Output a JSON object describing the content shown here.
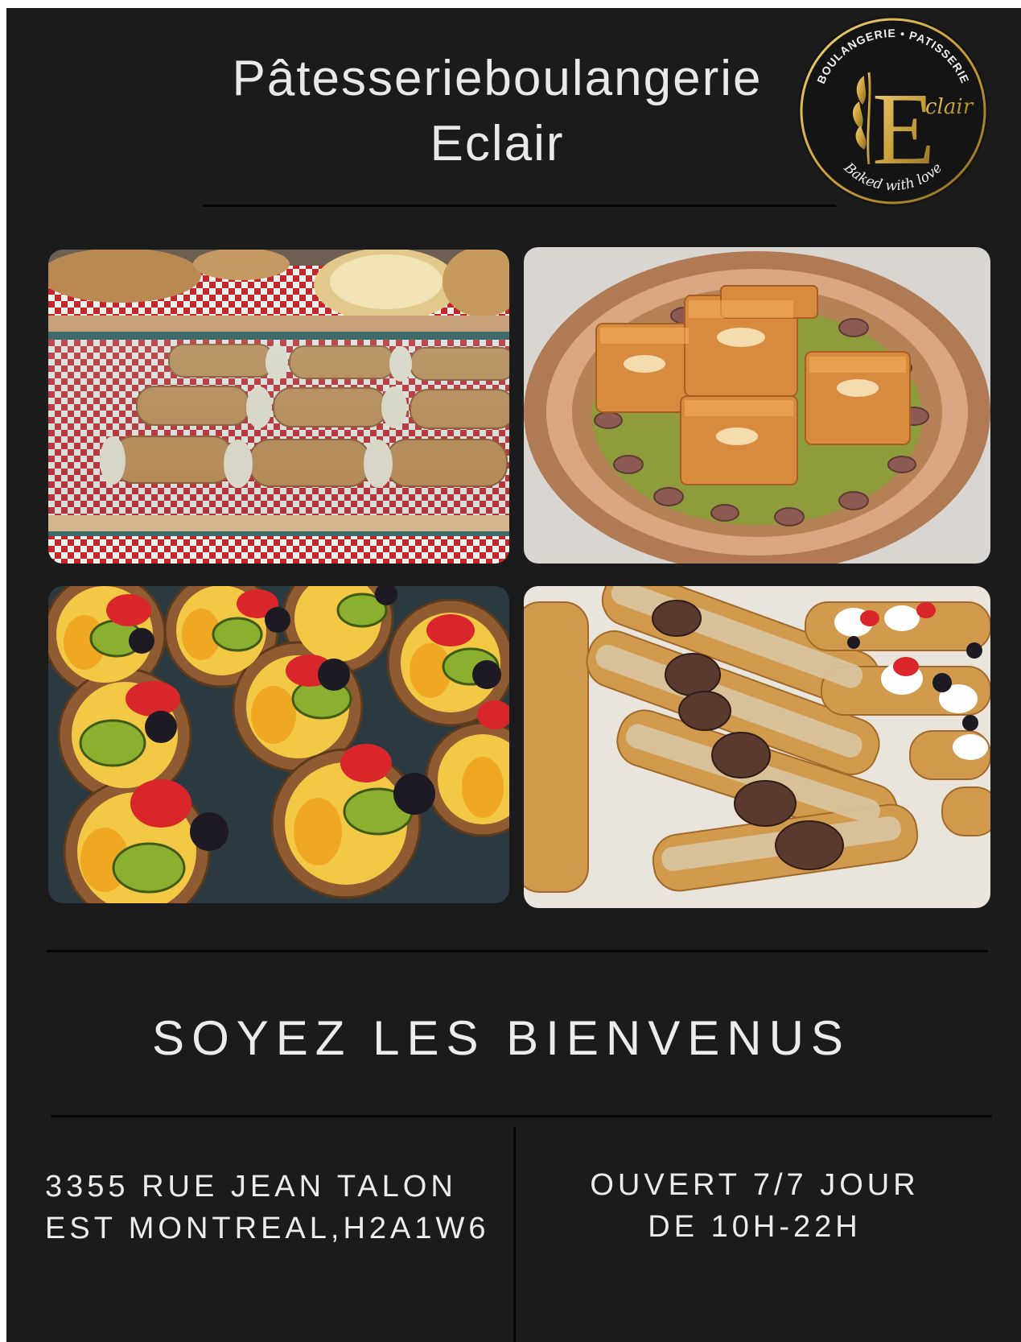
{
  "header": {
    "title_line1": "Pâtesserieboulangerie",
    "title_line2": "Eclair"
  },
  "logo": {
    "arc_text": "BOULANGERIE • PATISSERIE",
    "monogram": "E",
    "script": "clair",
    "tagline": "Baked with love",
    "colors": {
      "gold": "#c9a13b",
      "background": "#141414"
    }
  },
  "photos": [
    {
      "icon": "bakery-display-photo"
    },
    {
      "icon": "basbousa-photo"
    },
    {
      "icon": "fruit-tarts-photo"
    },
    {
      "icon": "eclairs-photo"
    }
  ],
  "welcome": "SOYEZ LES BIENVENUS",
  "address": {
    "line1": "3355 RUE JEAN TALON",
    "line2": "EST MONTREAL,H2A1W6"
  },
  "hours": {
    "line1": "OUVERT 7/7 JOUR",
    "line2": "DE 10H-22H"
  },
  "colors": {
    "page_background": "#1b1b1b",
    "text": "#ececec"
  }
}
